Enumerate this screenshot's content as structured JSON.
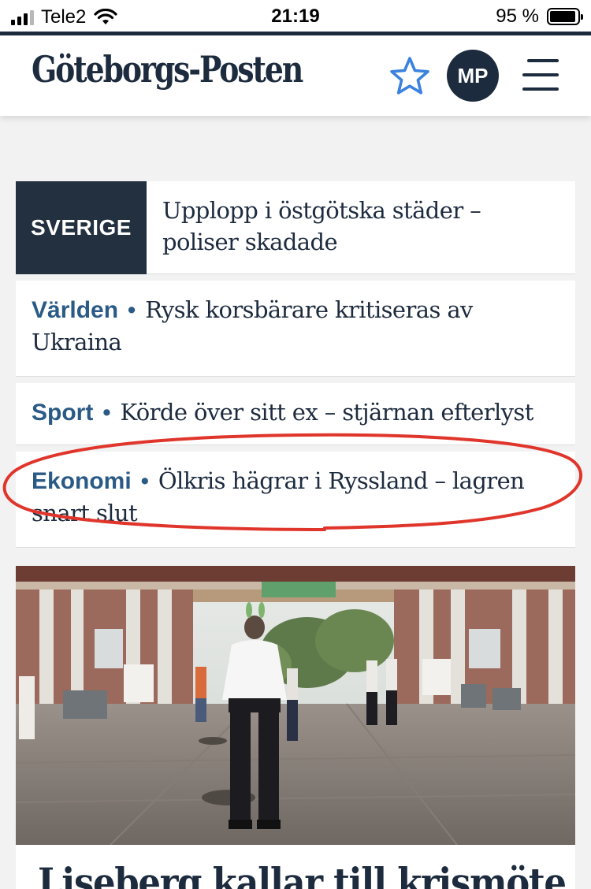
{
  "status_bar": {
    "carrier": "Tele2",
    "time": "21:19",
    "battery_percent": "95 %",
    "battery_level": 0.95
  },
  "header": {
    "logo_text": "Göteborgs-Posten",
    "star_icon": "star-outline-icon",
    "avatar_initials": "MP",
    "menu_icon": "hamburger-menu-icon"
  },
  "headlines": {
    "featured": {
      "tag": "SVERIGE",
      "title": "Upplopp i östgötska städer – poliser skadade"
    },
    "items": [
      {
        "section": "Världen",
        "separator": "•",
        "title": "Rysk korsbärare kritiseras av Ukraina"
      },
      {
        "section": "Sport",
        "separator": "•",
        "title": "Körde över sitt ex – stjärnan efterlyst"
      },
      {
        "section": "Ekonomi",
        "separator": "•",
        "title": "Ölkris hägrar i Ryssland – lagren snart slut"
      }
    ]
  },
  "hero": {
    "image_description": "amusement-park-entrance-photo",
    "headline": "Liseberg kallar till krismöte"
  },
  "colors": {
    "brand_navy": "#1d2b3e",
    "section_blue": "#2a5a86",
    "annotation_red": "#e0352b",
    "star_blue": "#3b82e0"
  }
}
